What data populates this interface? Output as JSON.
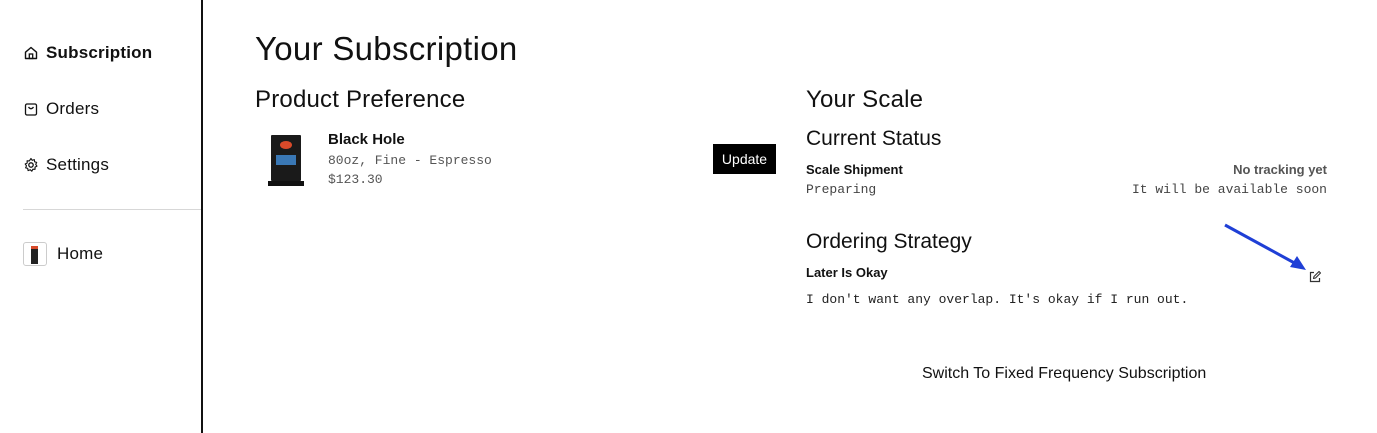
{
  "sidebar": {
    "items": [
      {
        "label": "Subscription",
        "icon": "home-icon"
      },
      {
        "label": "Orders",
        "icon": "bag-icon"
      },
      {
        "label": "Settings",
        "icon": "gear-icon"
      },
      {
        "label": "Home",
        "icon": "product-thumbnail"
      }
    ]
  },
  "main": {
    "title": "Your Subscription",
    "product_preference": {
      "heading": "Product Preference",
      "name": "Black Hole",
      "detail": "80oz, Fine - Espresso",
      "price": "$123.30",
      "update_label": "Update"
    },
    "scale": {
      "heading": "Your Scale",
      "status_heading": "Current Status",
      "shipment_label": "Scale Shipment",
      "shipment_value": "Preparing",
      "tracking_label": "No tracking yet",
      "tracking_value": "It will be available soon",
      "strategy_heading": "Ordering Strategy",
      "strategy_name": "Later Is Okay",
      "strategy_description": "I don't want any overlap. It's okay if I run out.",
      "switch_label": "Switch To Fixed Frequency Subscription"
    }
  },
  "colors": {
    "accent_arrow": "#1f3fd6",
    "button_bg": "#000000",
    "tracking_text": "#555555"
  }
}
